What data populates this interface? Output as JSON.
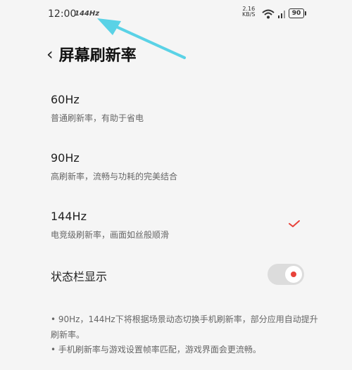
{
  "status_bar": {
    "time": "12:00",
    "refresh_badge": "144Hz",
    "network_speed_value": "2.16",
    "network_speed_unit": "KB/S",
    "battery": "90",
    "icons": [
      "wifi-icon",
      "signal-icon",
      "battery-icon"
    ]
  },
  "header": {
    "title": "屏幕刷新率"
  },
  "options": [
    {
      "title": "60Hz",
      "desc": "普通刷新率，有助于省电",
      "selected": false
    },
    {
      "title": "90Hz",
      "desc": "高刷新率，流畅与功耗的完美结合",
      "selected": false
    },
    {
      "title": "144Hz",
      "desc": "电竞级刷新率，画面如丝般顺滑",
      "selected": true
    }
  ],
  "status_bar_display": {
    "label": "状态栏显示",
    "enabled": true
  },
  "notes": [
    "• 90Hz，144Hz下将根据场景动态切换手机刷新率，部分应用自动提升刷新率。",
    "• 手机刷新率与游戏设置帧率匹配，游戏界面会更流畅。"
  ],
  "colors": {
    "accent": "#e8423a",
    "annotation_arrow": "#5ad2e6",
    "background": "#f5f5f5"
  }
}
